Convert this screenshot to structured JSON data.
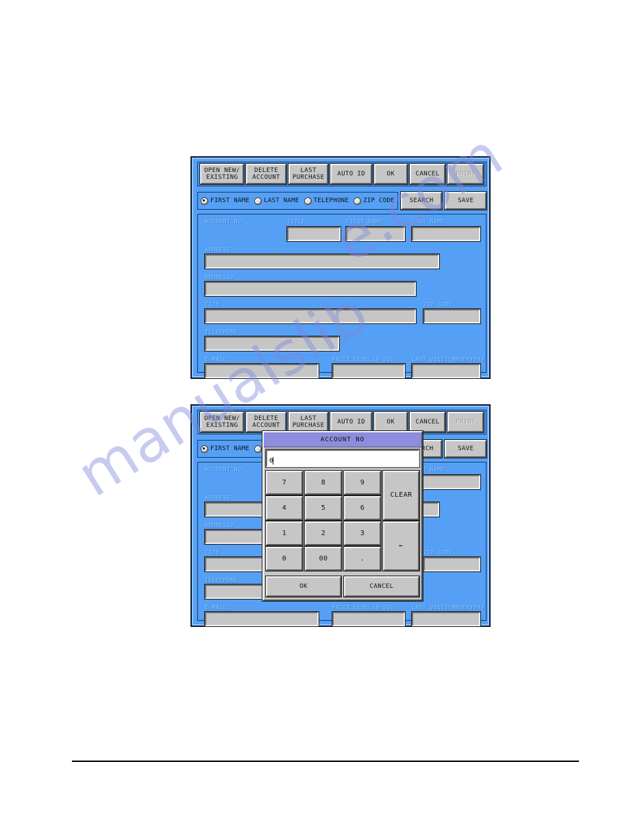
{
  "toolbar": {
    "buttons": [
      {
        "label": "OPEN NEW/\nEXISTING",
        "name": "open-new-existing-button",
        "disabled": false
      },
      {
        "label": "DELETE\nACCOUNT",
        "name": "delete-account-button",
        "disabled": false
      },
      {
        "label": "LAST\nPURCHASE",
        "name": "last-purchase-button",
        "disabled": false
      },
      {
        "label": "AUTO ID",
        "name": "auto-id-button",
        "disabled": false
      },
      {
        "label": "OK",
        "name": "ok-button",
        "disabled": false
      },
      {
        "label": "CANCEL",
        "name": "cancel-button",
        "disabled": false
      },
      {
        "label": "PRINT",
        "name": "print-button",
        "disabled": true
      }
    ]
  },
  "search_row": {
    "radios": [
      {
        "label": "FIRST NAME",
        "selected": true
      },
      {
        "label": "LAST NAME",
        "selected": false
      },
      {
        "label": "TELEPHONE",
        "selected": false
      },
      {
        "label": "ZIP CODE",
        "selected": false
      }
    ],
    "search_label": "SEARCH",
    "save_label": "SAVE"
  },
  "form": {
    "fields": [
      {
        "label": "ACCOUNT NO",
        "value": "",
        "has_input": false
      },
      {
        "label": "TITLE",
        "value": "",
        "has_input": true
      },
      {
        "label": "FIRST NAME",
        "value": "",
        "has_input": true
      },
      {
        "label": "LAST NAME",
        "value": "",
        "has_input": true
      },
      {
        "label": "ADDRESS",
        "value": "",
        "has_input": true
      },
      {
        "label": "ADDRESS2",
        "value": "",
        "has_input": true
      },
      {
        "label": "CITY",
        "value": "",
        "has_input": true
      },
      {
        "label": "ZIP CODE",
        "value": "",
        "has_input": true
      },
      {
        "label": "TELEPHONE",
        "value": "",
        "has_input": true
      },
      {
        "label": "E-MAIL",
        "value": "",
        "has_input": true
      },
      {
        "label": "PRICE LEVEL(0-20)",
        "value": "",
        "has_input": true
      },
      {
        "label": "LAST VISIT(MMDDYYYY)",
        "value": "",
        "has_input": true
      }
    ]
  },
  "keypad_dialog": {
    "title": "ACCOUNT NO",
    "input_value": "0",
    "keys": {
      "k7": "7",
      "k8": "8",
      "k9": "9",
      "k4": "4",
      "k5": "5",
      "k6": "6",
      "k1": "1",
      "k2": "2",
      "k3": "3",
      "k0": "0",
      "k00": "00",
      "kdot": ".",
      "clear": "CLEAR",
      "backspace": "←"
    },
    "ok_label": "OK",
    "cancel_label": "CANCEL"
  },
  "watermark": {
    "line_one": "manualslib",
    "line_two": "e.com"
  },
  "colors": {
    "screen_background": "#55a0f5",
    "button_face": "#c6c6c6",
    "dialog_title": "#8d8ddd",
    "label_text": "#8bc1f8",
    "watermark": "#7c86dd"
  }
}
